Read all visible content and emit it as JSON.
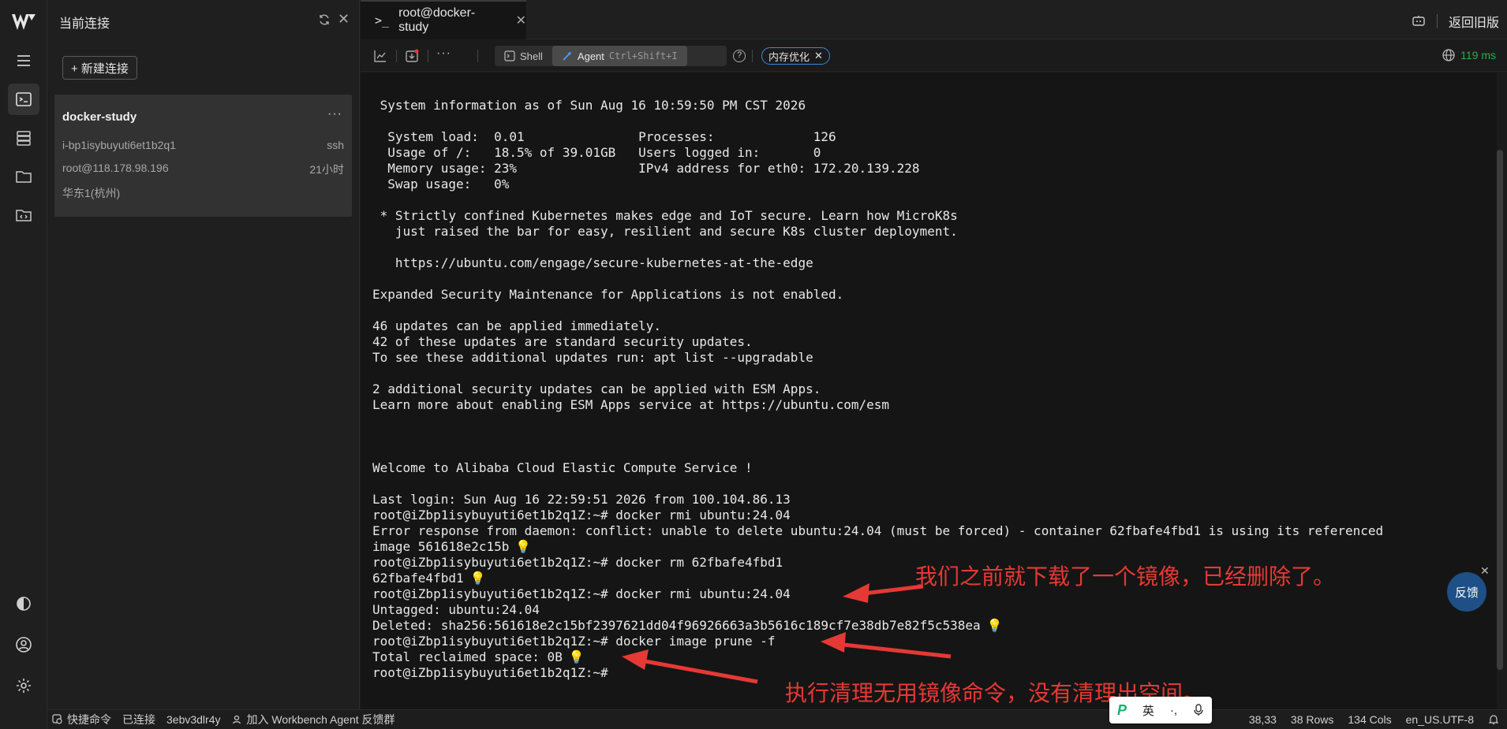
{
  "sidebar": {
    "panel_title": "当前连接",
    "new_connection_label": "+ 新建连接",
    "connection": {
      "name": "docker-study",
      "instance_id": "i-bp1isybuyuti6et1b2q1",
      "protocol": "ssh",
      "address": "root@118.178.98.196",
      "duration": "21小时",
      "region": "华东1(杭州)",
      "more_label": "···"
    }
  },
  "tab": {
    "prompt_icon": ">_",
    "title": "root@docker-study",
    "close_label": "✕"
  },
  "header": {
    "back_label": "返回旧版"
  },
  "toolbar": {
    "more_label": "···",
    "shell_label": "Shell",
    "agent_label": "Agent",
    "agent_shortcut": "Ctrl+Shift+I",
    "help_label": "?",
    "chip_label": "内存优化",
    "chip_close": "✕",
    "latency": "119 ms"
  },
  "terminal": {
    "lines": [
      " System information as of Sun Aug 16 10:59:50 PM CST 2026",
      "",
      "  System load:  0.01               Processes:             126",
      "  Usage of /:   18.5% of 39.01GB   Users logged in:       0",
      "  Memory usage: 23%                IPv4 address for eth0: 172.20.139.228",
      "  Swap usage:   0%",
      "",
      " * Strictly confined Kubernetes makes edge and IoT secure. Learn how MicroK8s",
      "   just raised the bar for easy, resilient and secure K8s cluster deployment.",
      "",
      "   https://ubuntu.com/engage/secure-kubernetes-at-the-edge",
      "",
      "Expanded Security Maintenance for Applications is not enabled.",
      "",
      "46 updates can be applied immediately.",
      "42 of these updates are standard security updates.",
      "To see these additional updates run: apt list --upgradable",
      "",
      "2 additional security updates can be applied with ESM Apps.",
      "Learn more about enabling ESM Apps service at https://ubuntu.com/esm",
      "",
      "",
      "",
      "Welcome to Alibaba Cloud Elastic Compute Service !",
      "",
      "Last login: Sun Aug 16 22:59:51 2026 from 100.104.86.13",
      "root@iZbp1isybuyuti6et1b2q1Z:~# docker rmi ubuntu:24.04",
      "Error response from daemon: conflict: unable to delete ubuntu:24.04 (must be forced) - container 62fbafe4fbd1 is using its referenced",
      "image 561618e2c15b",
      "root@iZbp1isybuyuti6et1b2q1Z:~# docker rm 62fbafe4fbd1",
      "62fbafe4fbd1",
      "root@iZbp1isybuyuti6et1b2q1Z:~# docker rmi ubuntu:24.04",
      "Untagged: ubuntu:24.04",
      "Deleted: sha256:561618e2c15bf2397621dd04f96926663a3b5616c189cf7e38db7e82f5c538ea",
      "root@iZbp1isybuyuti6et1b2q1Z:~# docker image prune -f",
      "Total reclaimed space: 0B",
      "root@iZbp1isybuyuti6et1b2q1Z:~#"
    ],
    "bulb_lines": [
      28,
      30,
      33,
      35
    ],
    "bulb_icon": "💡"
  },
  "annotations": {
    "note1": "我们之前就下载了一个镜像，已经删除了。",
    "note2": "执行清理无用镜像命令，没有清理出空间。",
    "color": "#e53935"
  },
  "feedback": {
    "label": "反馈",
    "close_label": "✕"
  },
  "statusbar": {
    "quick_cmd": "快捷命令",
    "connected": "已连接",
    "session_id": "3ebv3dlr4y",
    "join_group": "加入 Workbench Agent 反馈群",
    "cursor_pos": "38,33",
    "rows": "38 Rows",
    "cols": "134 Cols",
    "encoding": "en_US.UTF-8"
  },
  "ime": {
    "logo": "P",
    "lang": "英",
    "punct": "·,",
    "mic_icon": "mic-icon"
  },
  "colors": {
    "accent": "#3f86d8",
    "latency_green": "#27b04b",
    "bulb": "#f2c94c"
  }
}
